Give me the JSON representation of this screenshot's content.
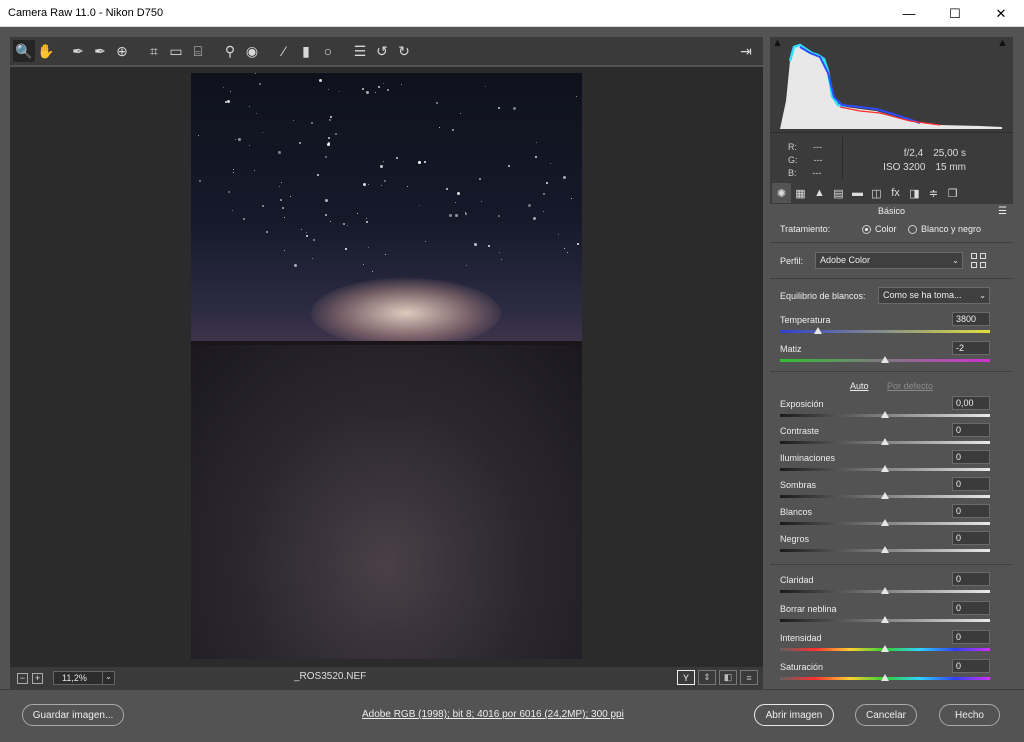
{
  "window": {
    "title": "Camera Raw 11.0 -  Nikon D750",
    "controls": [
      "—",
      "☐",
      "✕"
    ]
  },
  "toolbar": {
    "tools": [
      {
        "name": "zoom-tool-icon",
        "glyph": "🔍",
        "active": true
      },
      {
        "name": "hand-tool-icon",
        "glyph": "✋"
      },
      {
        "name": "white-balance-tool-icon",
        "glyph": "✒"
      },
      {
        "name": "color-sampler-tool-icon",
        "glyph": "✒"
      },
      {
        "name": "targeted-adjustment-tool-icon",
        "glyph": "⊕"
      },
      {
        "name": "crop-tool-icon",
        "glyph": "⌗"
      },
      {
        "name": "straighten-tool-icon",
        "glyph": "▭"
      },
      {
        "name": "transform-tool-icon",
        "glyph": "⌸"
      },
      {
        "name": "spot-removal-tool-icon",
        "glyph": "⚲"
      },
      {
        "name": "red-eye-tool-icon",
        "glyph": "◉"
      },
      {
        "name": "adjustment-brush-icon",
        "glyph": "⁄"
      },
      {
        "name": "graduated-filter-icon",
        "glyph": "▮"
      },
      {
        "name": "radial-filter-icon",
        "glyph": "○"
      },
      {
        "name": "preferences-icon",
        "glyph": "☰"
      },
      {
        "name": "rotate-left-icon",
        "glyph": "↺"
      },
      {
        "name": "rotate-right-icon",
        "glyph": "↻"
      }
    ],
    "export_glyph": "⇥"
  },
  "statusbar": {
    "zoom_out": "−",
    "zoom_in": "+",
    "zoom_value": "11,2%",
    "filename": "_ROS3520.NEF",
    "view_icons": [
      "Y",
      "⇕",
      "◧",
      "≡"
    ]
  },
  "histogram": {
    "colors": {
      "red": "#ff2d2d",
      "blue": "#2d4dff",
      "cyan": "#30e0ff",
      "white": "#f0f0f0"
    }
  },
  "info": {
    "r_label": "R:",
    "r_value": "---",
    "g_label": "G:",
    "g_value": "---",
    "b_label": "B:",
    "b_value": "---",
    "aperture": "f/2,4",
    "shutter": "25,00 s",
    "iso": "ISO 3200",
    "focal": "15 mm"
  },
  "panel_tabs": [
    {
      "name": "basic-tab-icon",
      "glyph": "✺",
      "selected": true
    },
    {
      "name": "tone-curve-tab-icon",
      "glyph": "▦"
    },
    {
      "name": "detail-tab-icon",
      "glyph": "▲"
    },
    {
      "name": "hsl-tab-icon",
      "glyph": "▤"
    },
    {
      "name": "split-toning-tab-icon",
      "glyph": "▬"
    },
    {
      "name": "lens-corrections-tab-icon",
      "glyph": "◫"
    },
    {
      "name": "effects-tab-icon",
      "glyph": "fx"
    },
    {
      "name": "camera-calibration-tab-icon",
      "glyph": "◨"
    },
    {
      "name": "presets-tab-icon",
      "glyph": "≑"
    },
    {
      "name": "snapshots-tab-icon",
      "glyph": "❐"
    }
  ],
  "basic": {
    "title": "Básico",
    "treatment_label": "Tratamiento:",
    "treatment_color": "Color",
    "treatment_bw": "Blanco y negro",
    "profile_label": "Perfil:",
    "profile_value": "Adobe Color",
    "wb_label": "Equilibrio de blancos:",
    "wb_value": "Como se ha toma...",
    "auto": "Auto",
    "default": "Por defecto",
    "wb_sliders": [
      {
        "id": "temperature",
        "label": "Temperatura",
        "value": "3800",
        "pos": 0.18,
        "track": "linear-gradient(to right, #3040d0, #e0e040)"
      },
      {
        "id": "tint",
        "label": "Matiz",
        "value": "-2",
        "pos": 0.5,
        "track": "linear-gradient(to right, #30c030, #d030d0)"
      }
    ],
    "tone_sliders": [
      {
        "id": "exposure",
        "label": "Exposición",
        "value": "0,00",
        "pos": 0.5
      },
      {
        "id": "contrast",
        "label": "Contraste",
        "value": "0",
        "pos": 0.5
      },
      {
        "id": "highlights",
        "label": "Iluminaciones",
        "value": "0",
        "pos": 0.5
      },
      {
        "id": "shadows",
        "label": "Sombras",
        "value": "0",
        "pos": 0.5
      },
      {
        "id": "whites",
        "label": "Blancos",
        "value": "0",
        "pos": 0.5
      },
      {
        "id": "blacks",
        "label": "Negros",
        "value": "0",
        "pos": 0.5
      }
    ],
    "presence_sliders": [
      {
        "id": "clarity",
        "label": "Claridad",
        "value": "0",
        "pos": 0.5,
        "track": "linear-gradient(to right, #1b1b1b, #e9e9e9)"
      },
      {
        "id": "dehaze",
        "label": "Borrar neblina",
        "value": "0",
        "pos": 0.5,
        "track": "linear-gradient(to right, #1b1b1b, #e9e9e9)"
      },
      {
        "id": "vibrance",
        "label": "Intensidad",
        "value": "0",
        "pos": 0.5,
        "track": "linear-gradient(to right, #606060, #ff3030, #ffd030, #30d030, #30d0ff, #3040ff, #d030ff)"
      },
      {
        "id": "saturation",
        "label": "Saturación",
        "value": "0",
        "pos": 0.5,
        "track": "linear-gradient(to right, #606060, #ff3030, #ffd030, #30d030, #30d0ff, #3040ff, #d030ff)"
      }
    ]
  },
  "bottom": {
    "save": "Guardar imagen...",
    "workflow": "Adobe RGB (1998); bit 8; 4016 por 6016 (24,2MP); 300 ppi",
    "open": "Abrir imagen",
    "cancel": "Cancelar",
    "done": "Hecho"
  }
}
